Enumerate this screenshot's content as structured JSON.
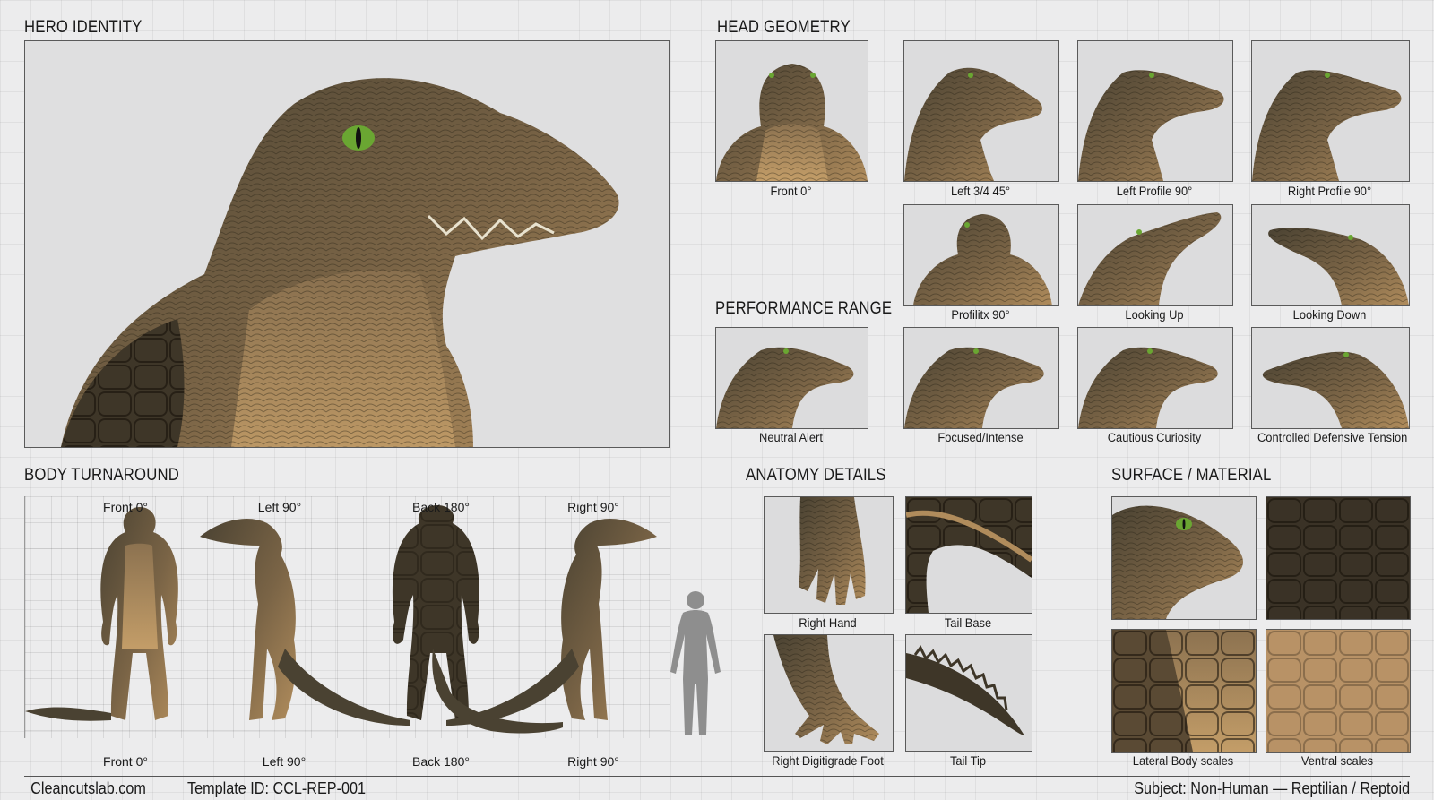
{
  "sections": {
    "hero": "HERO IDENTITY",
    "head": "HEAD GEOMETRY",
    "performance": "PERFORMANCE RANGE",
    "body": "BODY TURNAROUND",
    "anatomy": "ANATOMY DETAILS",
    "surface": "SURFACE / MATERIAL"
  },
  "head_views": [
    "Front 0°",
    "Left 3/4 45°",
    "Left Profile 90°",
    "Right Profile 90°",
    "Profilitx 90°",
    "Looking Up",
    "Looking Down"
  ],
  "performance_views": [
    "Neutral Alert",
    "Focused/Intense",
    "Cautious Curiosity",
    "Controlled Defensive Tension"
  ],
  "turnaround_top": [
    "Front 0°",
    "Left 90°",
    "Back 180°",
    "Right 90°"
  ],
  "turnaround_bottom": [
    "Front 0°",
    "Left 90°",
    "Back 180°",
    "Right 90°"
  ],
  "anatomy": [
    "Right Hand",
    "Tail Base",
    "Right Digitigrade Foot",
    "Tail Tip"
  ],
  "surface": [
    "",
    "",
    "Lateral Body scales",
    "Ventral scales"
  ],
  "footer": {
    "site": "Cleancutslab.com",
    "template": "Template ID: CCL-REP-001",
    "subject": "Subject: Non-Human — Reptilian / Reptoid"
  },
  "colors": {
    "skin_dark": "#4a4232",
    "skin_light": "#b08c5c",
    "eye": "#6aa632",
    "silhouette": "#8e8e8e"
  }
}
